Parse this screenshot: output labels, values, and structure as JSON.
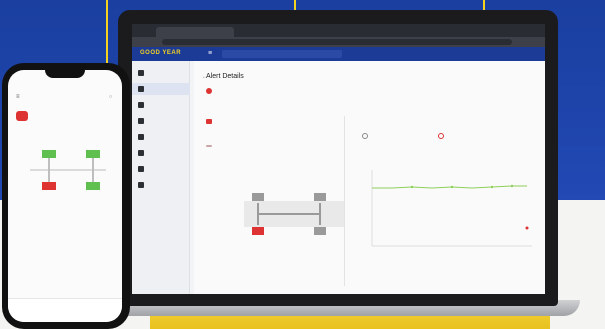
{
  "colors": {
    "brand_blue": "#1a3fa0",
    "accent_yellow": "#f5d21f",
    "alert_red": "#d33333",
    "ok_green": "#5fbf4f"
  },
  "browser": {
    "tab_title": "",
    "url": ""
  },
  "app": {
    "brand": "GOOD YEAR",
    "nav_badge": "",
    "user": ""
  },
  "sidebar": {
    "items": [
      {
        "label": ""
      },
      {
        "label": ""
      },
      {
        "label": ""
      },
      {
        "label": ""
      },
      {
        "label": ""
      },
      {
        "label": ""
      },
      {
        "label": ""
      },
      {
        "label": ""
      }
    ]
  },
  "content": {
    "breadcrumb": "",
    "title": "Alert Details",
    "top_actions": [
      "",
      ""
    ],
    "alert_text": "",
    "alert_link": "",
    "vehicle_section": "",
    "vehicle_label": "",
    "status_pill": "",
    "position_section": "",
    "history_section": ""
  },
  "phone": {
    "time": "",
    "title": "",
    "vehicle": "",
    "row_left": "",
    "row_right": "",
    "nav": [
      "",
      "",
      "",
      ""
    ]
  }
}
